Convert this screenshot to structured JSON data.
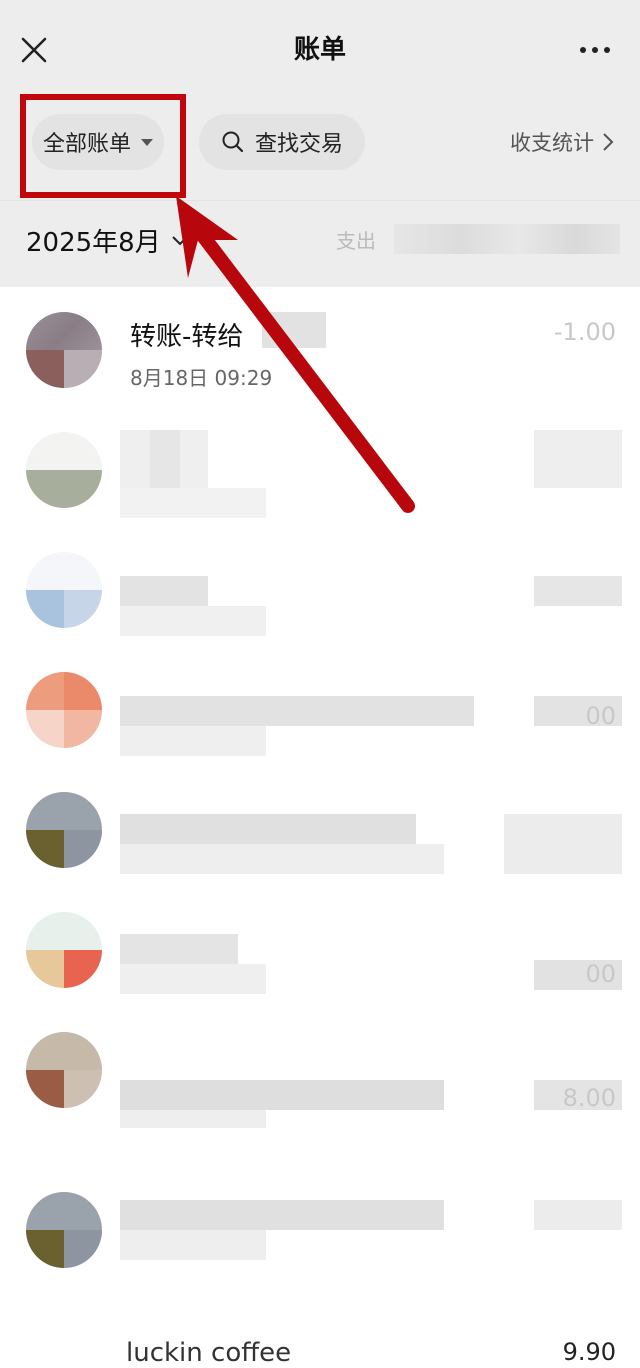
{
  "header": {
    "title": "账单",
    "close_icon": "close-icon",
    "more_icon": "more-icon"
  },
  "filters": {
    "all_bills_label": "全部账单",
    "search_label": "查找交易",
    "stats_label": "收支统计"
  },
  "month": {
    "label": "2025年8月",
    "summary_prefix": "支出"
  },
  "transactions": [
    {
      "title": "转账-转给",
      "time": "8月18日 09:29",
      "amount": "-1.00"
    },
    {
      "title": "",
      "time": "",
      "amount": ""
    },
    {
      "title": "",
      "time": "",
      "amount": ""
    },
    {
      "title": "",
      "time": "",
      "amount": "00"
    },
    {
      "title": "",
      "time": "",
      "amount": ""
    },
    {
      "title": "",
      "time": "",
      "amount": "00"
    },
    {
      "title": "",
      "time": "",
      "amount": "8.00"
    },
    {
      "title": "",
      "time": "",
      "amount": ""
    },
    {
      "title": "luckin coffee",
      "time": "",
      "amount": "9.90"
    }
  ],
  "colors": {
    "header_bg": "#ededed",
    "annotation_red": "#c0060c"
  }
}
